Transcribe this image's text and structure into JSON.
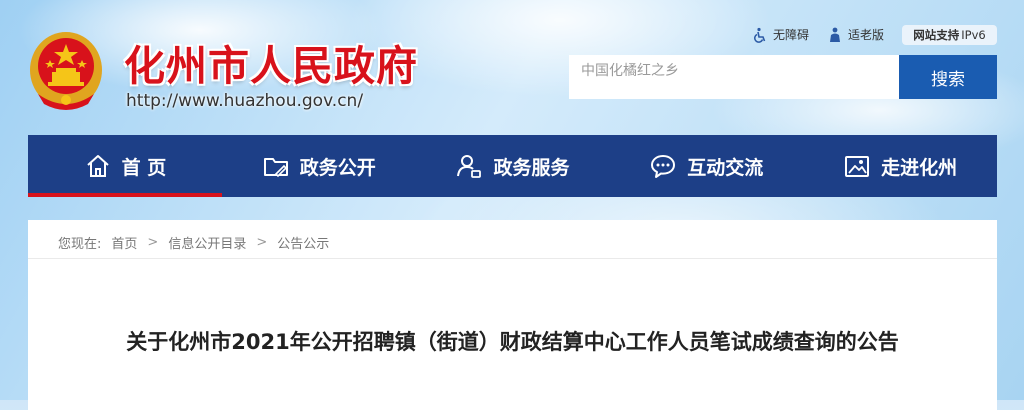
{
  "header": {
    "site_title": "化州市人民政府",
    "site_url": "http://www.huazhou.gov.cn/",
    "emblem_icon": "national-emblem"
  },
  "utility": {
    "accessible_label": "无障碍",
    "elderly_label": "适老版",
    "ipv6_bold": "网站支持",
    "ipv6_text": "IPv6"
  },
  "search": {
    "placeholder": "中国化橘红之乡",
    "button_label": "搜索"
  },
  "nav": {
    "items": [
      {
        "label": "首 页",
        "icon": "home-icon"
      },
      {
        "label": "政务公开",
        "icon": "folder-icon"
      },
      {
        "label": "政务服务",
        "icon": "user-service-icon"
      },
      {
        "label": "互动交流",
        "icon": "chat-icon"
      },
      {
        "label": "走进化州",
        "icon": "picture-icon"
      }
    ],
    "active_index": 0
  },
  "breadcrumb": {
    "prefix": "您现在:",
    "items": [
      "首页",
      "信息公开目录",
      "公告公示"
    ],
    "separator": ">"
  },
  "article": {
    "title": "关于化州市2021年公开招聘镇（街道）财政结算中心工作人员笔试成绩查询的公告"
  },
  "colors": {
    "brand_red": "#d8121b",
    "nav_blue": "#1d3f87",
    "search_blue": "#1a5cb1"
  }
}
